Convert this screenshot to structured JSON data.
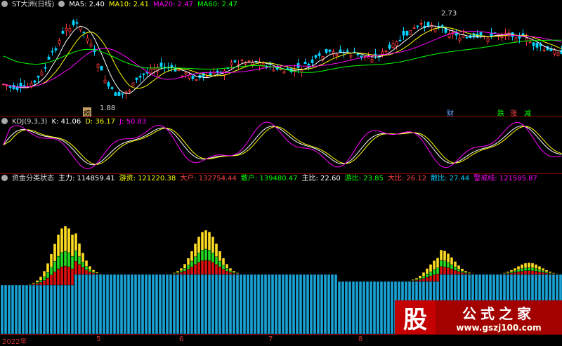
{
  "main_panel": {
    "stock_name": "ST大洲(日线)",
    "ma5": "MA5: 2.40",
    "ma10": "MA10: 2.41",
    "ma20": "MA20: 2.47",
    "ma60": "MA60: 2.47",
    "high_label": "2.73",
    "low_label": "1.88",
    "event_tags": [
      "榜",
      "财",
      "跌",
      "涨",
      "减"
    ],
    "colors": {
      "up": "#ff3b3b",
      "down": "#00d2ff",
      "ma5": "#ffffff",
      "ma10": "#ffff00",
      "ma20": "#ff00ff",
      "ma60": "#00ff00"
    }
  },
  "kdj_panel": {
    "title": "KDJ(9,3,3)",
    "k": "K: 41.06",
    "d": "D: 36.17",
    "j": "J: 50.83"
  },
  "fund_panel": {
    "title": "资金分类状态",
    "zhuli": "主力: 114859.41",
    "youzi": "游资: 121220.38",
    "dahu": "大户: 132754.44",
    "sanhu": "散户: 139480.47",
    "zhubi": "主比: 22.60",
    "youbi": "游比: 23.85",
    "dabi": "大比: 26.12",
    "sanbi": "散比: 27.44",
    "jingjie": "警戒线: 121585.87"
  },
  "x_axis": {
    "labels": [
      "2022年",
      "5",
      "6",
      "7",
      "8"
    ]
  },
  "watermark": {
    "icon": "股",
    "title": "公式之家",
    "url": "www.gszj100.com"
  }
}
